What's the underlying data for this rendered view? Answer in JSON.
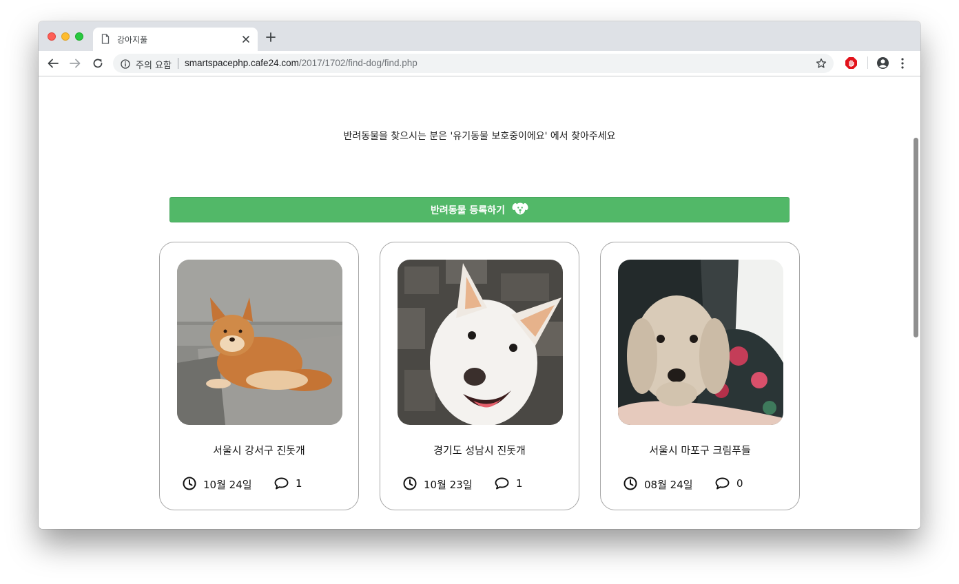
{
  "browser": {
    "tab_title": "강아지풀",
    "security_label": "주의 요함",
    "url_host": "smartspacephp.cafe24.com",
    "url_path": "/2017/1702/find-dog/find.php"
  },
  "page": {
    "notice": "반려동물을 찾으시는 분은 '유기동물 보호중이에요' 에서 찾아주세요",
    "register_button": "반려동물 등록하기"
  },
  "cards": [
    {
      "title": "서울시 강서구 진돗개",
      "date": "10월 24일",
      "comments": "1"
    },
    {
      "title": "경기도 성남시 진돗개",
      "date": "10월 23일",
      "comments": "1"
    },
    {
      "title": "서울시 마포구 크림푸들",
      "date": "08월 24일",
      "comments": "0"
    }
  ],
  "colors": {
    "accent_green": "#52b868",
    "tabstrip": "#dee1e6",
    "card_border": "#a6a6a6"
  },
  "icons": {
    "tab": [
      "page-icon",
      "close-icon",
      "plus-icon"
    ],
    "toolbar": [
      "back-arrow-icon",
      "forward-arrow-icon",
      "reload-icon",
      "info-icon",
      "star-icon",
      "adblock-icon",
      "profile-icon",
      "menu-dots-icon"
    ],
    "content": [
      "dog-face-icon",
      "clock-icon",
      "comment-bubble-icon"
    ]
  }
}
